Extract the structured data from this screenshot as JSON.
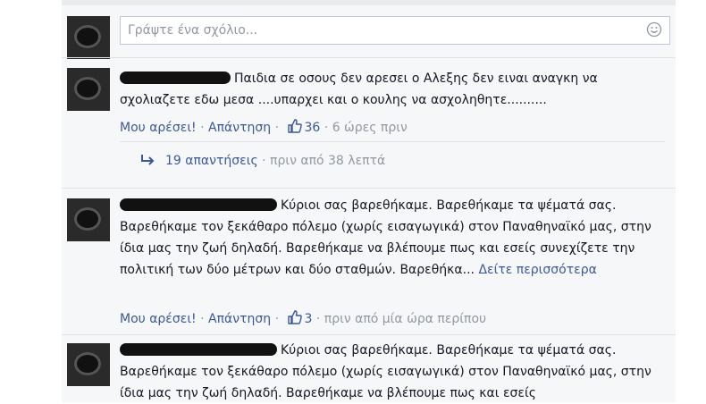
{
  "composer": {
    "placeholder": "Γράψτε ένα σχόλιο..."
  },
  "comments": [
    {
      "text": "Παιδια σε οσους δεν αρεσει ο Αλεξης δεν ειναι αναγκη να σχολιαζετε εδω μεσα ....υπαρχει και ο κουλης να ασχοληθητε..........",
      "like_label": "Μου αρέσει!",
      "reply_label": "Απάντηση",
      "likes": "36",
      "time": "6 ώρες πριν",
      "replies": "19 απαντήσεις",
      "replies_time": "πριν από 38 λεπτά"
    },
    {
      "text": "Κύριοι σας βαρεθήκαμε. Βαρεθήκαμε τα ψέματά σας. Βαρεθήκαμε τον ξεκάθαρο πόλεμο (χωρίς εισαγωγικά) στον Παναθηναϊκό μας, στην ίδια μας την ζωή δηλαδή. Βαρεθήκαμε να βλέπουμε πως και εσείς συνεχίζετε την πολιτική των δύο μέτρων και δύο σταθμών. Βαρεθήκα...",
      "see_more": "Δείτε περισσότερα",
      "like_label": "Μου αρέσει!",
      "reply_label": "Απάντηση",
      "likes": "3",
      "time": "πριν από μία ώρα περίπου"
    },
    {
      "text": "Κύριοι σας βαρεθήκαμε. Βαρεθήκαμε τα ψέματά σας. Βαρεθήκαμε τον ξεκάθαρο πόλεμο (χωρίς εισαγωγικά) στον Παναθηναϊκό μας, στην ίδια μας την ζωή δηλαδή. Βαρεθήκαμε να βλέπουμε πως και εσείς"
    }
  ],
  "colors": {
    "link": "#3b5998",
    "meta": "#9197a3",
    "panel_bg": "#f6f7f9"
  },
  "icons": [
    "smiley-icon",
    "thumbs-up-icon",
    "reply-arrow-icon"
  ]
}
